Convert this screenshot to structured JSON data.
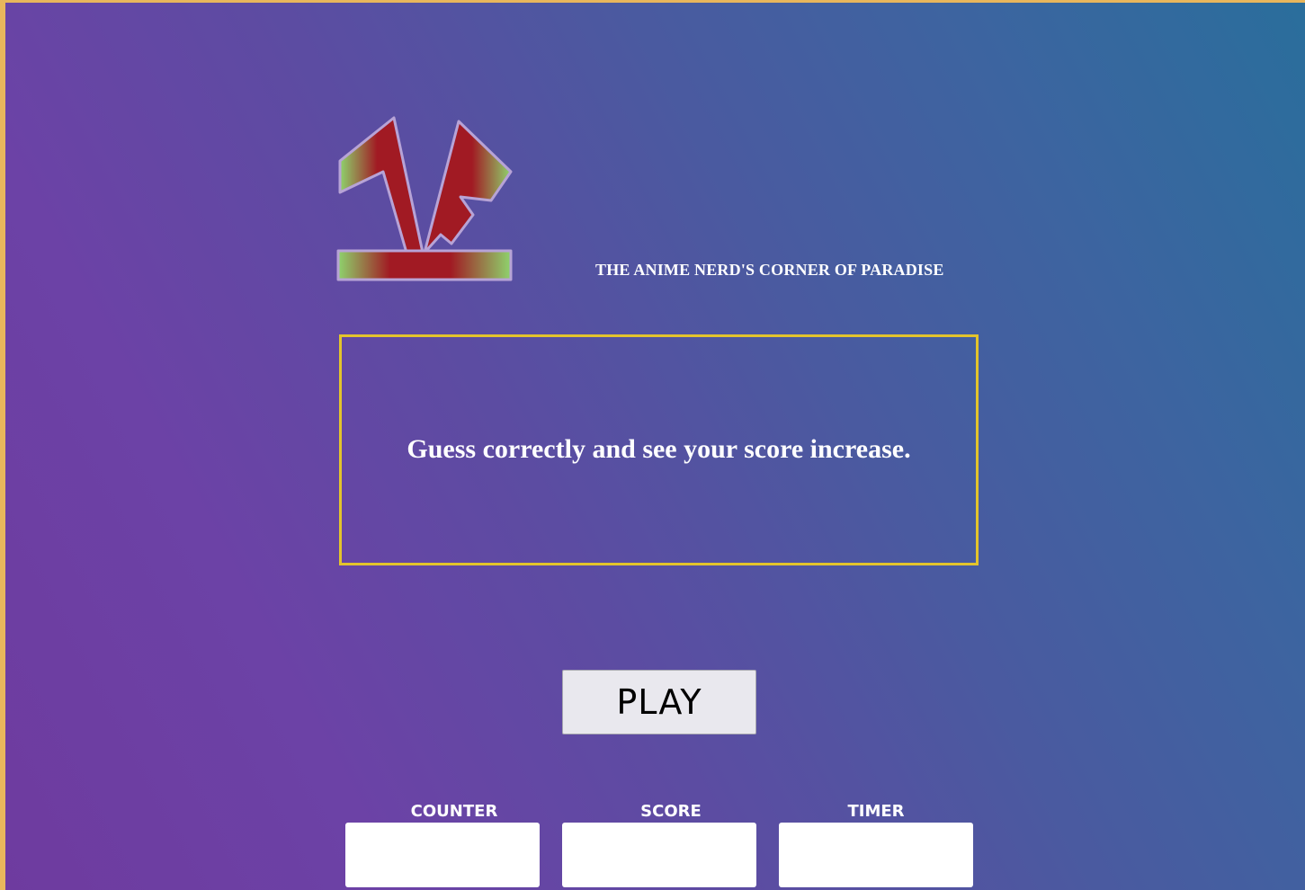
{
  "header": {
    "tagline": "THE ANIME NERD'S CORNER OF PARADISE"
  },
  "logo": {
    "icon": "anime-nerd-logo",
    "colors": [
      "#8ed36c",
      "#a11a23",
      "#b7a3d6"
    ]
  },
  "message": {
    "text": "Guess correctly and see your score increase."
  },
  "play": {
    "label": "PLAY"
  },
  "stats": {
    "counter": {
      "label": "COUNTER",
      "value": ""
    },
    "score": {
      "label": "SCORE",
      "value": ""
    },
    "timer": {
      "label": "TIMER",
      "value": ""
    }
  },
  "theme": {
    "accent_border": "#e3c42c",
    "frame": "#e8b65c",
    "gradient_start": "#6e3b9f",
    "gradient_end": "#2a6e9c"
  }
}
